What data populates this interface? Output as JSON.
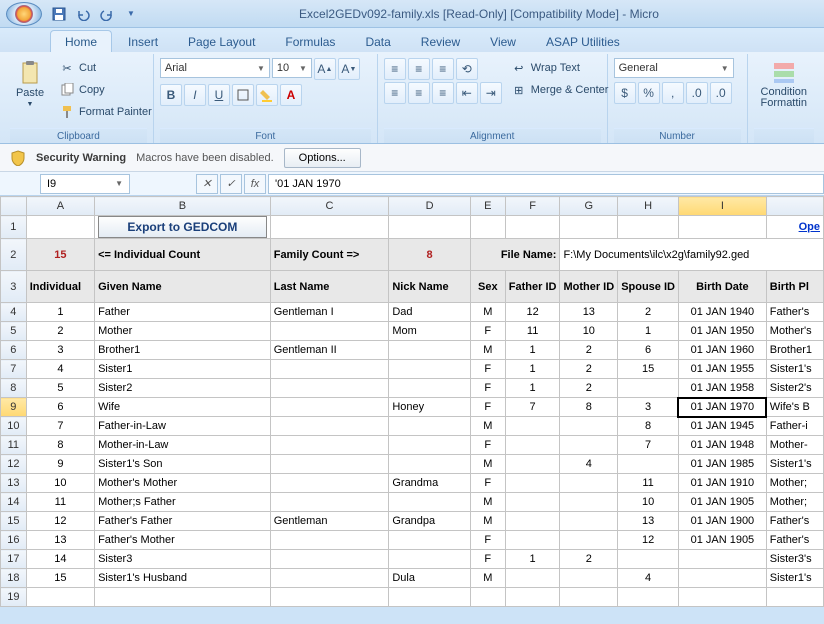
{
  "title": "Excel2GEDv092-family.xls  [Read-Only]  [Compatibility Mode] - Micro",
  "tabs": [
    "Home",
    "Insert",
    "Page Layout",
    "Formulas",
    "Data",
    "Review",
    "View",
    "ASAP Utilities"
  ],
  "activeTab": 0,
  "ribbon": {
    "clipboard": {
      "label": "Clipboard",
      "paste": "Paste",
      "cut": "Cut",
      "copy": "Copy",
      "fp": "Format Painter"
    },
    "font": {
      "label": "Font",
      "name": "Arial",
      "size": "10"
    },
    "alignment": {
      "label": "Alignment",
      "wrap": "Wrap Text",
      "merge": "Merge & Center"
    },
    "number": {
      "label": "Number",
      "format": "General"
    },
    "cond": {
      "label": "Condition\nFormattin"
    }
  },
  "security": {
    "title": "Security Warning",
    "msg": "Macros have been disabled.",
    "btn": "Options..."
  },
  "namebox": "I9",
  "formula": "'01 JAN 1970",
  "columns": [
    "A",
    "B",
    "C",
    "D",
    "E",
    "F",
    "G",
    "H",
    "I",
    ""
  ],
  "row1": {
    "export": "Export to GEDCOM",
    "open": "Ope"
  },
  "row2": {
    "count": "15",
    "indLabel": "<= Individual Count",
    "famLabel": "Family Count =>",
    "famCount": "8",
    "fileLabel": "File Name:",
    "filePath": "F:\\My Documents\\ilc\\x2g\\family92.ged"
  },
  "headers": {
    "ind": "Individual",
    "given": "Given Name",
    "last": "Last Name",
    "nick": "Nick Name",
    "sex": "Sex",
    "father": "Father ID",
    "mother": "Mother ID",
    "spouse": "Spouse ID",
    "birth": "Birth Date",
    "bplace": "Birth Pl"
  },
  "rows": [
    {
      "n": "1",
      "given": "Father",
      "last": "Gentleman I",
      "nick": "Dad",
      "sex": "M",
      "f": "12",
      "m": "13",
      "s": "2",
      "b": "01 JAN 1940",
      "bp": "Father's"
    },
    {
      "n": "2",
      "given": "Mother",
      "last": "",
      "nick": "Mom",
      "sex": "F",
      "f": "11",
      "m": "10",
      "s": "1",
      "b": "01 JAN 1950",
      "bp": "Mother's"
    },
    {
      "n": "3",
      "given": "Brother1",
      "last": "Gentleman II",
      "nick": "",
      "sex": "M",
      "f": "1",
      "m": "2",
      "s": "6",
      "b": "01 JAN 1960",
      "bp": "Brother1"
    },
    {
      "n": "4",
      "given": "Sister1",
      "last": "",
      "nick": "",
      "sex": "F",
      "f": "1",
      "m": "2",
      "s": "15",
      "b": "01 JAN 1955",
      "bp": "Sister1's"
    },
    {
      "n": "5",
      "given": "Sister2",
      "last": "",
      "nick": "",
      "sex": "F",
      "f": "1",
      "m": "2",
      "s": "",
      "b": "01 JAN 1958",
      "bp": "Sister2's"
    },
    {
      "n": "6",
      "given": "Wife",
      "last": "",
      "nick": "Honey",
      "sex": "F",
      "f": "7",
      "m": "8",
      "s": "3",
      "b": "01 JAN 1970",
      "bp": "Wife's B"
    },
    {
      "n": "7",
      "given": "Father-in-Law",
      "last": "",
      "nick": "",
      "sex": "M",
      "f": "",
      "m": "",
      "s": "8",
      "b": "01 JAN 1945",
      "bp": "Father-i"
    },
    {
      "n": "8",
      "given": "Mother-in-Law",
      "last": "",
      "nick": "",
      "sex": "F",
      "f": "",
      "m": "",
      "s": "7",
      "b": "01 JAN 1948",
      "bp": "Mother-"
    },
    {
      "n": "9",
      "given": "Sister1's Son",
      "last": "",
      "nick": "",
      "sex": "M",
      "f": "",
      "m": "4",
      "s": "",
      "b": "01 JAN 1985",
      "bp": "Sister1's"
    },
    {
      "n": "10",
      "given": "Mother's Mother",
      "last": "",
      "nick": "Grandma",
      "sex": "F",
      "f": "",
      "m": "",
      "s": "11",
      "b": "01 JAN 1910",
      "bp": "Mother;"
    },
    {
      "n": "11",
      "given": "Mother;s Father",
      "last": "",
      "nick": "",
      "sex": "M",
      "f": "",
      "m": "",
      "s": "10",
      "b": "01 JAN 1905",
      "bp": "Mother;"
    },
    {
      "n": "12",
      "given": "Father's Father",
      "last": "Gentleman",
      "nick": "Grandpa",
      "sex": "M",
      "f": "",
      "m": "",
      "s": "13",
      "b": "01 JAN 1900",
      "bp": "Father's"
    },
    {
      "n": "13",
      "given": "Father's Mother",
      "last": "",
      "nick": "",
      "sex": "F",
      "f": "",
      "m": "",
      "s": "12",
      "b": "01 JAN 1905",
      "bp": "Father's"
    },
    {
      "n": "14",
      "given": "Sister3",
      "last": "",
      "nick": "",
      "sex": "F",
      "f": "1",
      "m": "2",
      "s": "",
      "b": "",
      "bp": "Sister3's"
    },
    {
      "n": "15",
      "given": "Sister1's Husband",
      "last": "",
      "nick": "Dula",
      "sex": "M",
      "f": "",
      "m": "",
      "s": "4",
      "b": "",
      "bp": "Sister1's"
    }
  ],
  "selectedCol": "I",
  "selectedRow": 9
}
